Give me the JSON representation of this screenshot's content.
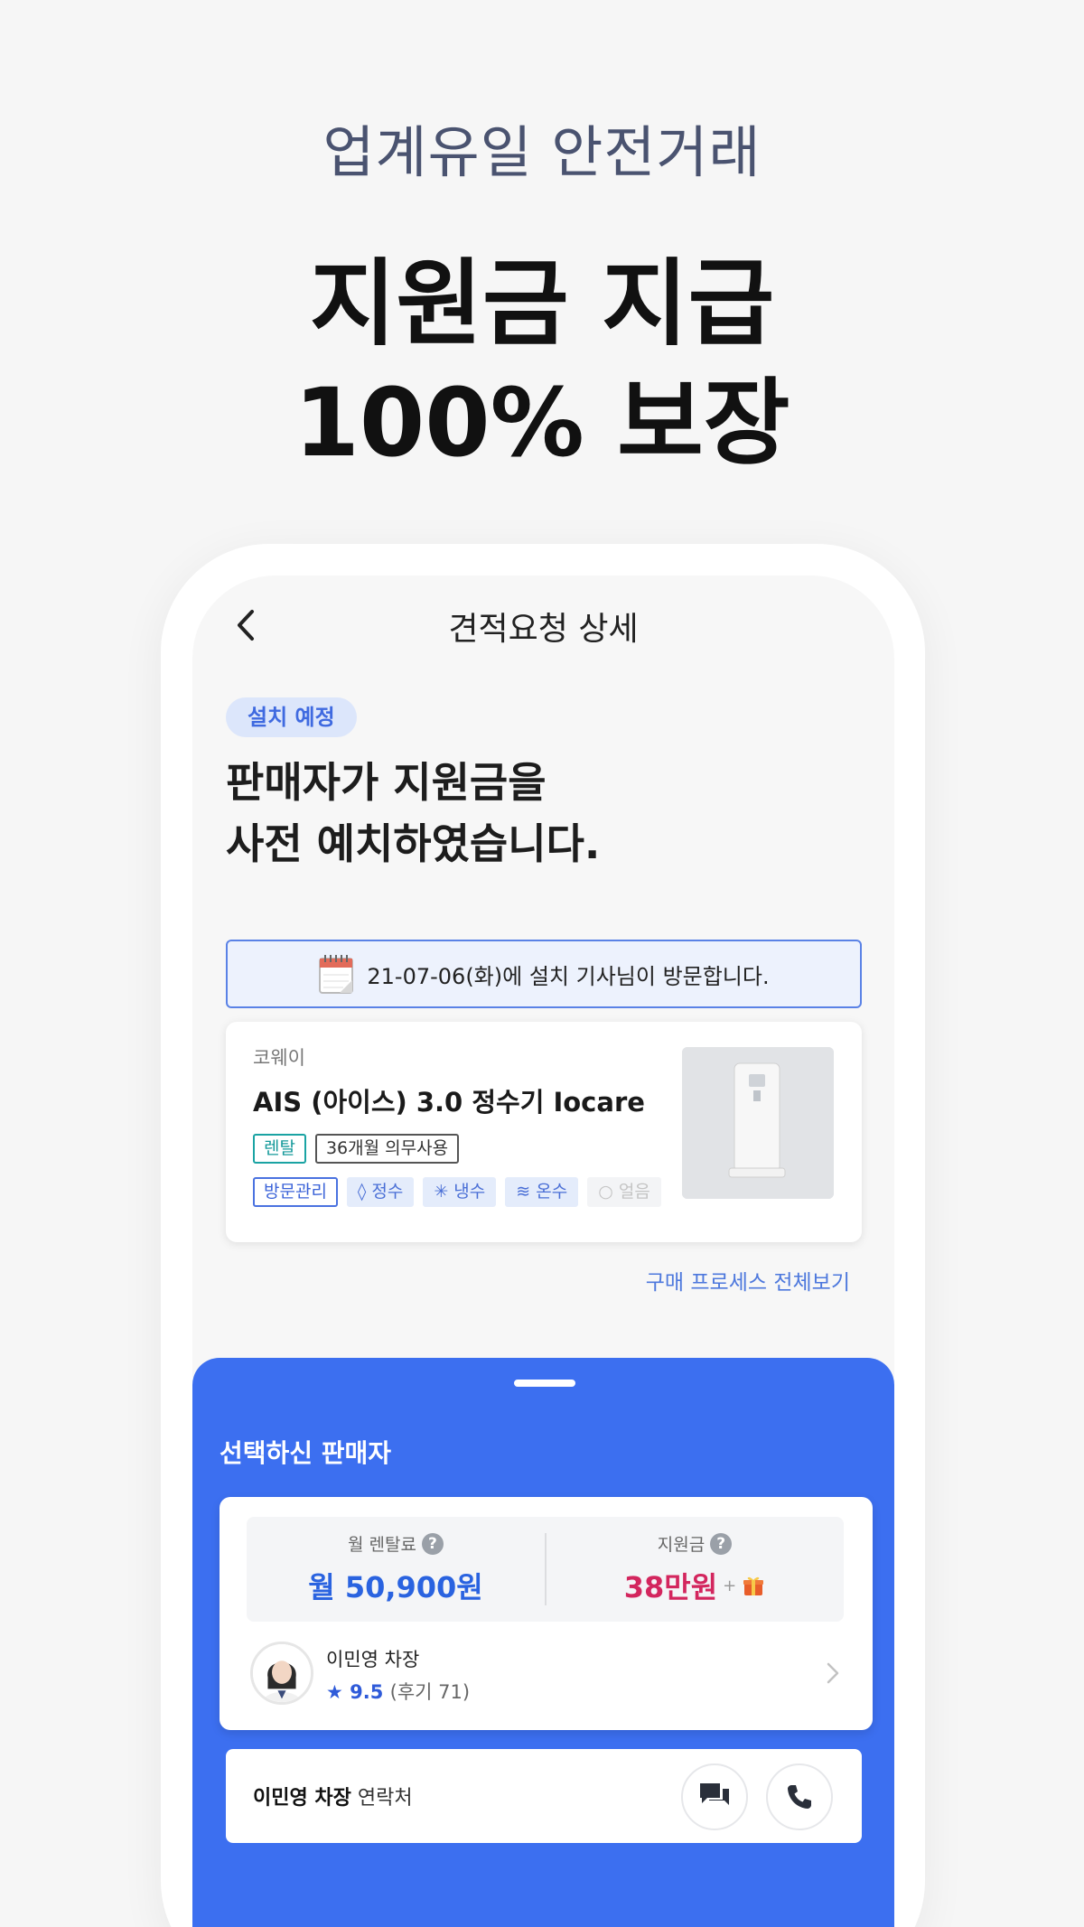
{
  "hero": {
    "subtitle": "업계유일 안전거래",
    "title_line1": "지원금 지급",
    "title_line2": "100% 보장"
  },
  "nav": {
    "title": "견적요청 상세",
    "back_icon": "chevron-left-icon"
  },
  "status": {
    "badge": "설치 예정",
    "headline_line1": "판매자가 지원금을",
    "headline_line2": "사전 예치하였습니다."
  },
  "notice": {
    "text": "21-07-06(화)에 설치 기사님이 방문합니다.",
    "icon": "calendar-icon"
  },
  "product": {
    "brand": "코웨이",
    "name": "AIS (아이스) 3.0 정수기 Iocare",
    "tags_primary": [
      "렌탈",
      "36개월 의무사용"
    ],
    "management_tag": "방문관리",
    "features": [
      {
        "label": "정수",
        "symbol": "◊"
      },
      {
        "label": "냉수",
        "symbol": "✳"
      },
      {
        "label": "온수",
        "symbol": "≋"
      }
    ],
    "disabled_feature": {
      "label": "얼음",
      "symbol": "○"
    }
  },
  "process_link": "구매 프로세스 전체보기",
  "sheet": {
    "title": "선택하신 판매자",
    "rental_label": "월 렌탈료",
    "rental_value": "월 50,900원",
    "subsidy_label": "지원금",
    "subsidy_value": "38만원",
    "plus": "+",
    "help": "?",
    "seller_name": "이민영 차장",
    "rating_star": "★",
    "rating": "9.5",
    "reviews": "(후기 71)",
    "contact_name": "이민영 차장",
    "contact_suffix": "연락처"
  },
  "colors": {
    "accent": "#3c6ff0",
    "pink": "#d3265e",
    "badge_bg": "#dce6fb"
  }
}
